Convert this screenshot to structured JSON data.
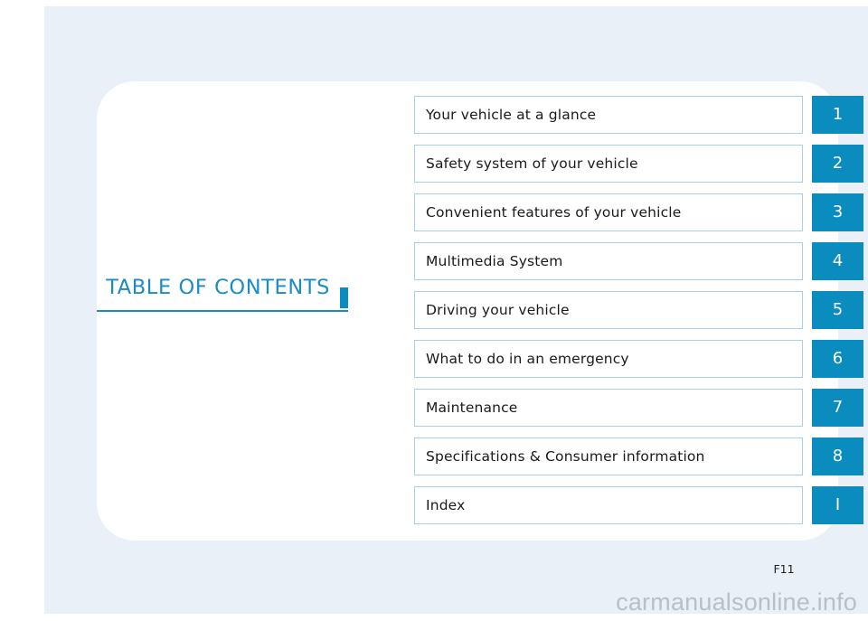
{
  "page": {
    "title": "TABLE OF CONTENTS",
    "page_number": "F11",
    "watermark": "carmanualsonline.info",
    "colors": {
      "accent_blue": "#0b8cbf",
      "title_blue": "#1a8cc4",
      "row_border": "#a8cfe4",
      "sheet_background": "#e9f0f8",
      "card_background": "#ffffff",
      "watermark_gray": "#b9bfc6"
    }
  },
  "toc": {
    "rows": [
      {
        "label": "Your vehicle at a glance",
        "tab": "1"
      },
      {
        "label": "Safety system of your vehicle",
        "tab": "2"
      },
      {
        "label": "Convenient features of your vehicle",
        "tab": "3"
      },
      {
        "label": "Multimedia System",
        "tab": "4"
      },
      {
        "label": "Driving your vehicle",
        "tab": "5"
      },
      {
        "label": "What to do in an emergency",
        "tab": "6"
      },
      {
        "label": "Maintenance",
        "tab": "7"
      },
      {
        "label": "Specifications & Consumer information",
        "tab": "8"
      },
      {
        "label": "Index",
        "tab": "I"
      }
    ]
  }
}
